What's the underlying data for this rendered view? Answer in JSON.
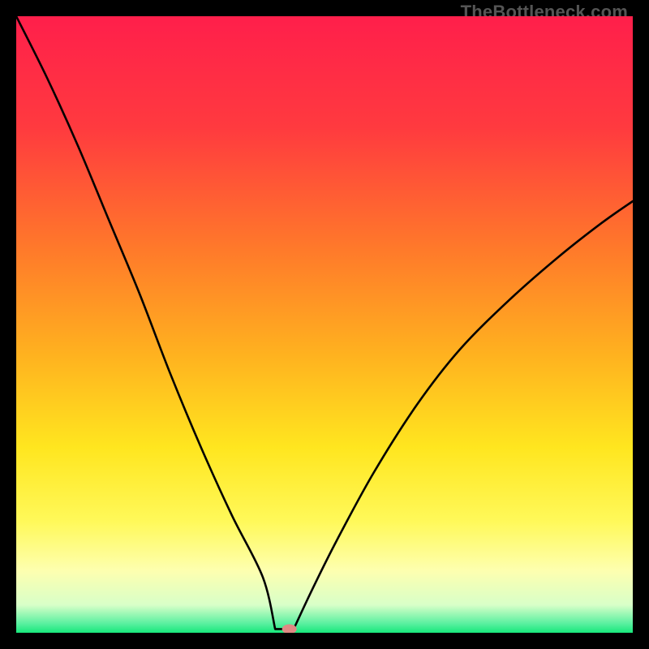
{
  "watermark": "TheBottleneck.com",
  "chart_data": {
    "type": "line",
    "title": "",
    "xlabel": "",
    "ylabel": "",
    "xlim": [
      0,
      100
    ],
    "ylim": [
      0,
      100
    ],
    "gradient_stops": [
      {
        "offset": 0.0,
        "color": "#ff1f4b"
      },
      {
        "offset": 0.18,
        "color": "#ff3a3f"
      },
      {
        "offset": 0.38,
        "color": "#ff7a2a"
      },
      {
        "offset": 0.55,
        "color": "#ffb21f"
      },
      {
        "offset": 0.7,
        "color": "#ffe61f"
      },
      {
        "offset": 0.82,
        "color": "#fff95a"
      },
      {
        "offset": 0.9,
        "color": "#fdffb0"
      },
      {
        "offset": 0.955,
        "color": "#d8ffc8"
      },
      {
        "offset": 0.985,
        "color": "#5af0a0"
      },
      {
        "offset": 1.0,
        "color": "#17e87b"
      }
    ],
    "series": [
      {
        "name": "bottleneck-curve",
        "x": [
          0,
          5,
          10,
          15,
          20,
          25,
          30,
          35,
          40,
          42,
          43.5,
          45,
          48,
          52,
          58,
          65,
          72,
          80,
          88,
          95,
          100
        ],
        "y": [
          100,
          90,
          79,
          67,
          55,
          42,
          30,
          19,
          9,
          3.5,
          0.6,
          2,
          7,
          15,
          26,
          37,
          46,
          54,
          61,
          66.5,
          70
        ]
      }
    ],
    "plateau": {
      "x_start": 42.0,
      "x_end": 45.0,
      "y": 0.6
    },
    "marker": {
      "x": 44.3,
      "y": 0.6,
      "color": "#e08a84",
      "rx": 9,
      "ry": 6
    }
  }
}
